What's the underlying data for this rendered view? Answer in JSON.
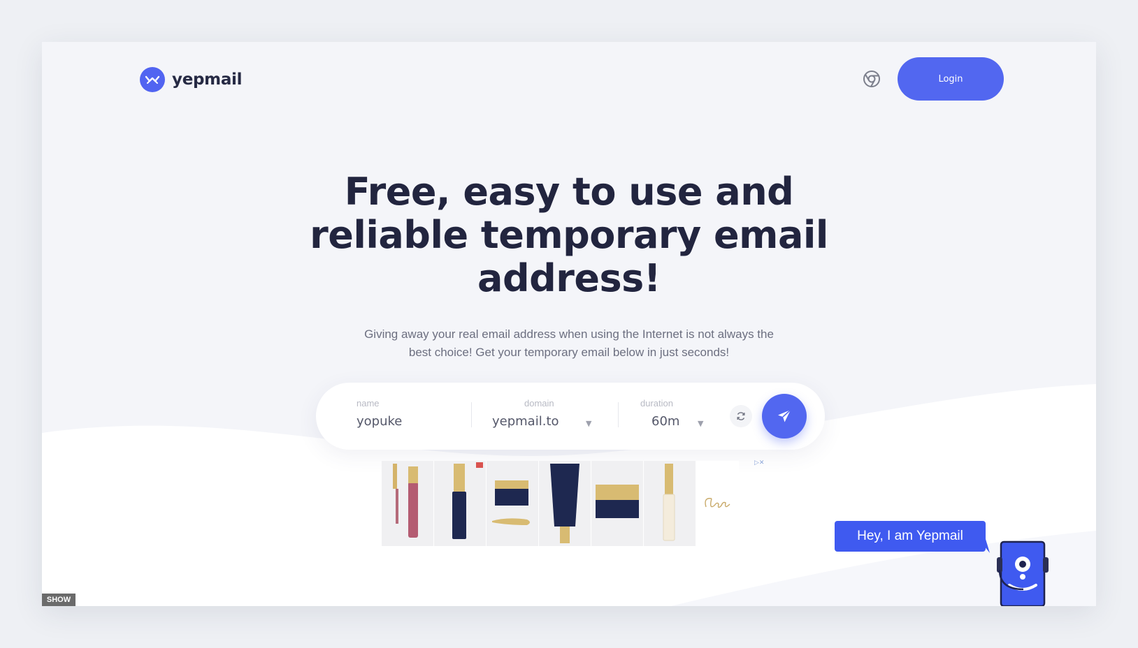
{
  "brand": {
    "name": "yepmail",
    "accent_color": "#5267f0",
    "logo_icon": "envelope-check-icon"
  },
  "header": {
    "browser_icon": "chrome-icon",
    "login_label": "Login"
  },
  "hero": {
    "title": "Free, easy to use and reliable temporary email address!",
    "subtitle": "Giving away your real email address when using the Internet is not always the best choice! Get your temporary email below in just seconds!"
  },
  "form": {
    "name_label": "name",
    "name_value": "yopuke",
    "domain_label": "domain",
    "domain_value": "yepmail.to",
    "duration_label": "duration",
    "duration_value": "60m",
    "refresh_icon": "refresh-icon",
    "send_icon": "paper-plane-icon"
  },
  "ad": {
    "badge_icon": "adchoices-icon"
  },
  "chat": {
    "bubble_text": "Hey, I am Yepmail",
    "mascot_icon": "robot-mascot-icon"
  },
  "footer": {
    "show_label": "SHOW"
  }
}
